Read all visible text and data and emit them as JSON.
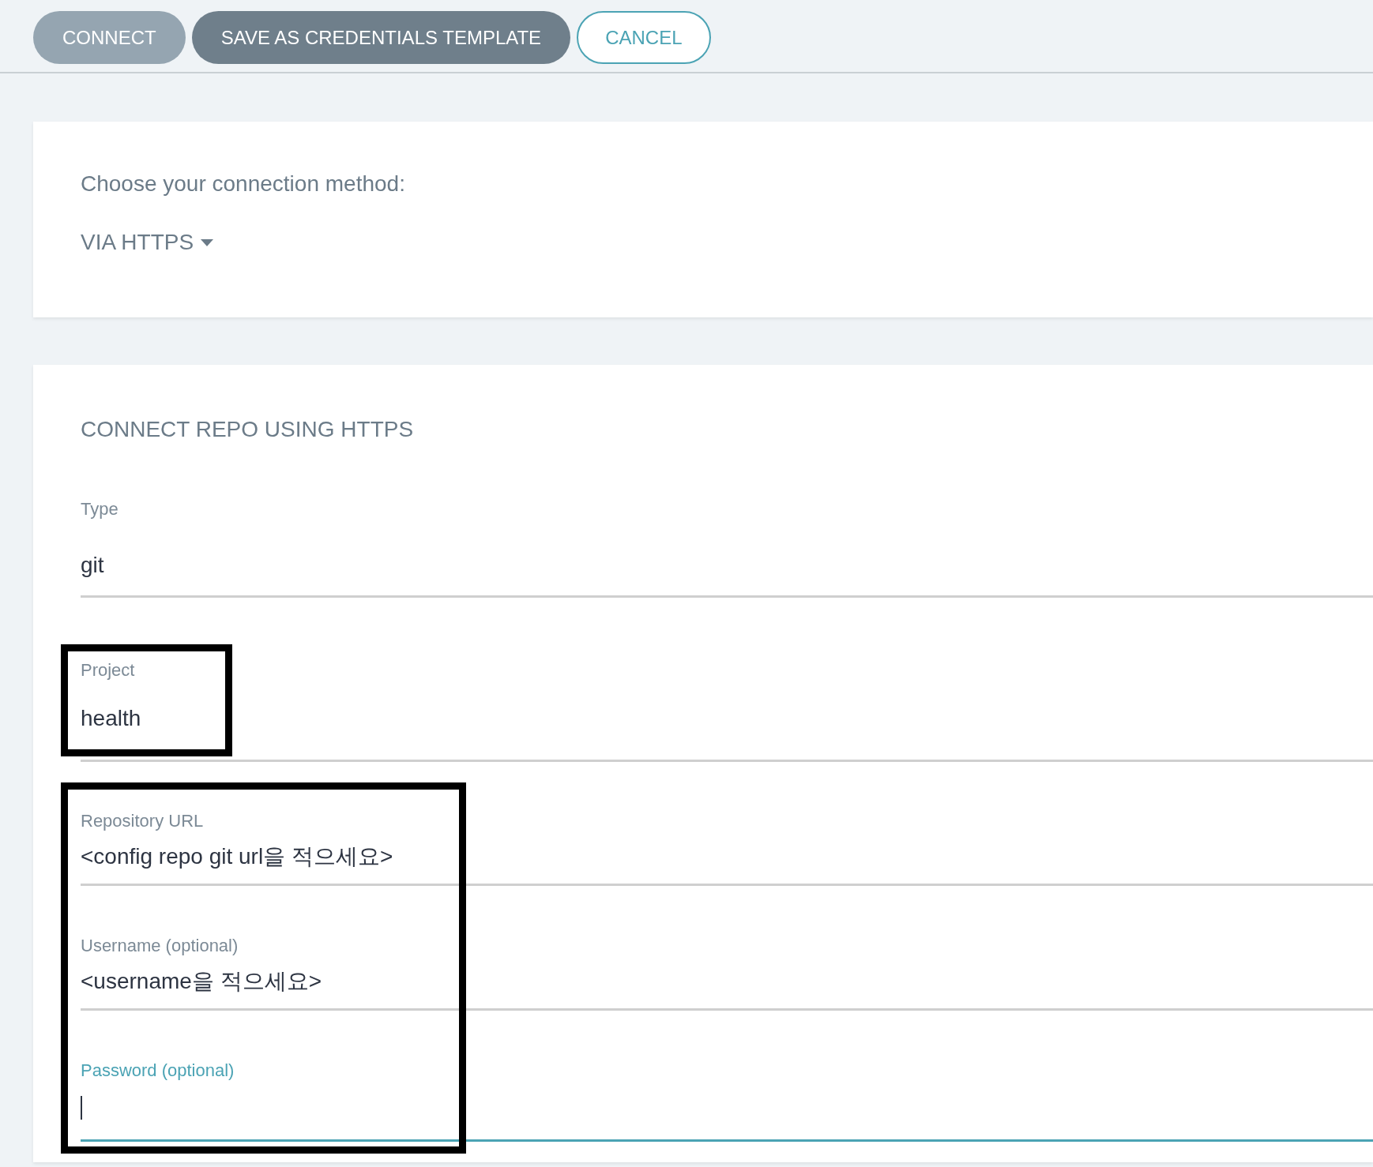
{
  "toolbar": {
    "buttons": [
      {
        "label": "CONNECT",
        "kind": "primary",
        "disabled": true
      },
      {
        "label": "SAVE AS CREDENTIALS TEMPLATE",
        "kind": "primary",
        "disabled": false
      },
      {
        "label": "CANCEL",
        "kind": "outline",
        "disabled": false
      }
    ]
  },
  "method_card": {
    "prompt": "Choose your connection method:",
    "dropdown": {
      "value": "VIA HTTPS"
    }
  },
  "form_card": {
    "title": "CONNECT REPO USING HTTPS",
    "groups": [
      {
        "fields": [
          {
            "label": "Type",
            "value": "git",
            "focused": false
          }
        ]
      },
      {
        "framed": true,
        "fields": [
          {
            "label": "Project",
            "value": "health",
            "focused": false
          }
        ]
      },
      {
        "framed": true,
        "fields": [
          {
            "label": "Repository URL",
            "value": "<config repo git url을 적으세요>",
            "focused": false
          },
          {
            "label": "Username (optional)",
            "value": "<username을 적으세요>",
            "focused": false
          },
          {
            "label": "Password (optional)",
            "focused": true
          }
        ]
      }
    ]
  }
}
